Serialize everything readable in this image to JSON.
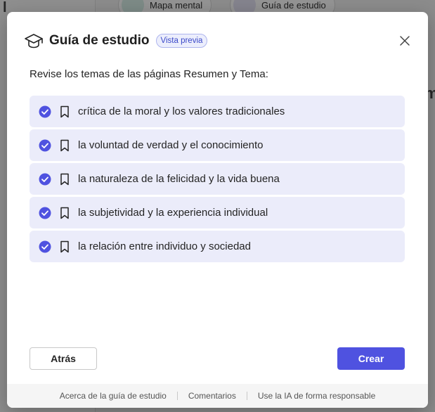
{
  "background": {
    "chips": [
      {
        "label": "Mapa mental"
      },
      {
        "label": "Guía de estudio"
      }
    ]
  },
  "dialog": {
    "title": "Guía de estudio",
    "badge": "Vista previa",
    "close_icon": "close-icon",
    "header_icon": "graduation-cap-icon",
    "instructions": "Revise los temas de las páginas Resumen y Tema:",
    "topics": [
      {
        "label": "crítica de la moral y los valores tradicionales",
        "checked": true
      },
      {
        "label": "la voluntad de verdad y el conocimiento",
        "checked": true
      },
      {
        "label": "la naturaleza de la felicidad y la vida buena",
        "checked": true
      },
      {
        "label": "la subjetividad y la experiencia individual",
        "checked": true
      },
      {
        "label": "la relación entre individuo y sociedad",
        "checked": true
      }
    ],
    "back_label": "Atrás",
    "create_label": "Crear",
    "footer": {
      "about_label": "Acerca de la guía de estudio",
      "feedback_label": "Comentarios",
      "responsible_ai_label": "Use la IA de forma responsable"
    }
  },
  "colors": {
    "accent": "#4f52e0",
    "topic_bg": "#ebecfa",
    "badge_text": "#3b49c9"
  }
}
